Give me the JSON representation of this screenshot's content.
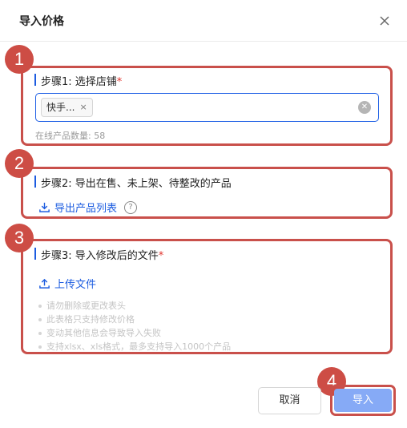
{
  "dialog": {
    "title": "导入价格",
    "close_icon": "close-icon"
  },
  "annotations": [
    "1",
    "2",
    "3",
    "4"
  ],
  "step1": {
    "title": "步骤1: 选择店铺",
    "required_mark": "*",
    "selected_tag": "快手...",
    "tag_remove": "×",
    "product_count": "在线产品数量: 58"
  },
  "step2": {
    "title": "步骤2: 导出在售、未上架、待整改的产品",
    "export_link": "导出产品列表",
    "help": "?"
  },
  "step3": {
    "title": "步骤3: 导入修改后的文件",
    "required_mark": "*",
    "upload_link": "上传文件",
    "tips": [
      "请勿删除或更改表头",
      "此表格只支持修改价格",
      "变动其他信息会导致导入失败",
      "支持xlsx、xls格式，最多支持导入1000个产品"
    ]
  },
  "footer": {
    "cancel_label": "取消",
    "import_label": "导入"
  },
  "colors": {
    "accent": "#1c5ce0",
    "annotation_red": "#c9504b",
    "primary_disabled": "#86aaf6"
  }
}
